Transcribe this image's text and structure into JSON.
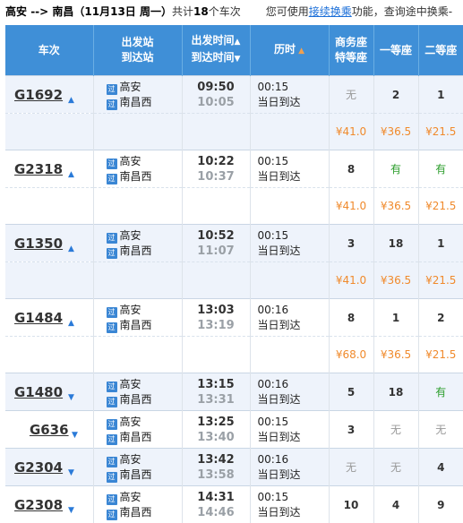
{
  "topbar": {
    "from": "高安",
    "sep": " --> ",
    "to": "南昌",
    "date_text": "（11月13日  周一）",
    "total_prefix": "共计",
    "total_count": "18",
    "total_suffix": "个车次",
    "hint_prefix": "您可使用",
    "hint_link": "接续换乘",
    "hint_suffix": "功能，查询途中换乘-"
  },
  "columns": {
    "train": "车次",
    "station_1": "出发站",
    "station_2": "到达站",
    "time_1": "出发时间",
    "time_2": "到达时间",
    "duration": "历时",
    "business_1": "商务座",
    "business_2": "特等座",
    "first": "一等座",
    "second": "二等座"
  },
  "icons": {
    "pass_badge": "过",
    "arrow_up": "▲",
    "arrow_down": "▼"
  },
  "colors": {
    "header_bg": "#3f8fd7",
    "row_alt_bg": "#eef3fb",
    "price": "#f08a2c",
    "available": "#2c9e2c",
    "none": "#999999"
  },
  "trains": [
    {
      "code": "G1692",
      "dir": "up",
      "from": "高安",
      "to": "南昌西",
      "dep": "09:50",
      "arr": "10:05",
      "dur": "00:15",
      "arrive_day": "当日到达",
      "business": "无",
      "first": "2",
      "second": "1",
      "price_business": "¥41.0",
      "price_first": "¥36.5",
      "price_second": "¥21.5"
    },
    {
      "code": "G2318",
      "dir": "up",
      "from": "高安",
      "to": "南昌西",
      "dep": "10:22",
      "arr": "10:37",
      "dur": "00:15",
      "arrive_day": "当日到达",
      "business": "8",
      "first": "有",
      "second": "有",
      "price_business": "¥41.0",
      "price_first": "¥36.5",
      "price_second": "¥21.5"
    },
    {
      "code": "G1350",
      "dir": "up",
      "from": "高安",
      "to": "南昌西",
      "dep": "10:52",
      "arr": "11:07",
      "dur": "00:15",
      "arrive_day": "当日到达",
      "business": "3",
      "first": "18",
      "second": "1",
      "price_business": "¥41.0",
      "price_first": "¥36.5",
      "price_second": "¥21.5"
    },
    {
      "code": "G1484",
      "dir": "up",
      "from": "高安",
      "to": "南昌西",
      "dep": "13:03",
      "arr": "13:19",
      "dur": "00:16",
      "arrive_day": "当日到达",
      "business": "8",
      "first": "1",
      "second": "2",
      "price_business": "¥68.0",
      "price_first": "¥36.5",
      "price_second": "¥21.5"
    },
    {
      "code": "G1480",
      "dir": "down",
      "from": "高安",
      "to": "南昌西",
      "dep": "13:15",
      "arr": "13:31",
      "dur": "00:16",
      "arrive_day": "当日到达",
      "business": "5",
      "first": "18",
      "second": "有"
    },
    {
      "code": "G636",
      "dir": "down",
      "from": "高安",
      "to": "南昌西",
      "dep": "13:25",
      "arr": "13:40",
      "dur": "00:15",
      "arrive_day": "当日到达",
      "business": "3",
      "first": "无",
      "second": "无"
    },
    {
      "code": "G2304",
      "dir": "down",
      "from": "高安",
      "to": "南昌西",
      "dep": "13:42",
      "arr": "13:58",
      "dur": "00:16",
      "arrive_day": "当日到达",
      "business": "无",
      "first": "无",
      "second": "4"
    },
    {
      "code": "G2308",
      "dir": "down",
      "from": "高安",
      "to": "南昌西",
      "dep": "14:31",
      "arr": "14:46",
      "dur": "00:15",
      "arrive_day": "当日到达",
      "business": "10",
      "first": "4",
      "second": "9"
    }
  ]
}
